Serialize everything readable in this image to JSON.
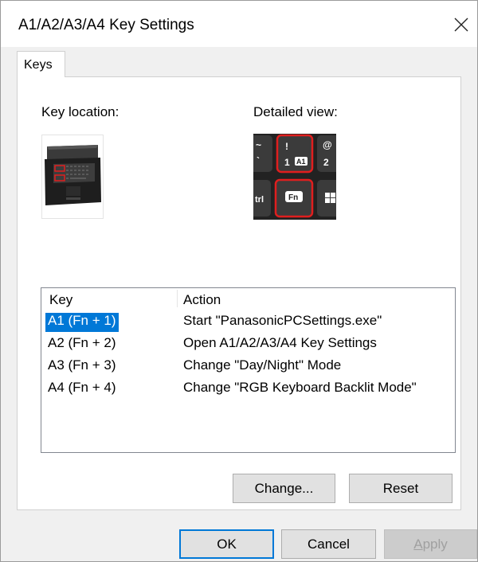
{
  "window": {
    "title": "A1/A2/A3/A4 Key Settings"
  },
  "tabs": [
    {
      "label": "Keys"
    }
  ],
  "section": {
    "key_location_label": "Key location:",
    "detailed_view_label": "Detailed view:"
  },
  "detail_keys": {
    "tilde_top": "~",
    "tilde_bottom": "`",
    "key1_top": "!",
    "key1_bottom": "1",
    "key1_badge": "A1",
    "key2_top": "@",
    "key2_bottom": "2",
    "ctrl": "trl",
    "fn": "Fn"
  },
  "table": {
    "headers": {
      "key": "Key",
      "action": "Action"
    },
    "rows": [
      {
        "key": "A1 (Fn + 1)",
        "action": "Start \"PanasonicPCSettings.exe\""
      },
      {
        "key": "A2 (Fn + 2)",
        "action": "Open A1/A2/A3/A4 Key Settings"
      },
      {
        "key": "A3 (Fn + 3)",
        "action": "Change \"Day/Night\" Mode"
      },
      {
        "key": "A4 (Fn + 4)",
        "action": "Change \"RGB Keyboard Backlit Mode\""
      }
    ],
    "selected_index": 0
  },
  "buttons": {
    "change": "Change...",
    "reset": "Reset",
    "ok": "OK",
    "cancel": "Cancel",
    "apply_first": "A",
    "apply_rest": "pply"
  },
  "colors": {
    "selection": "#0078d7",
    "highlight_red": "#e01e1e"
  }
}
